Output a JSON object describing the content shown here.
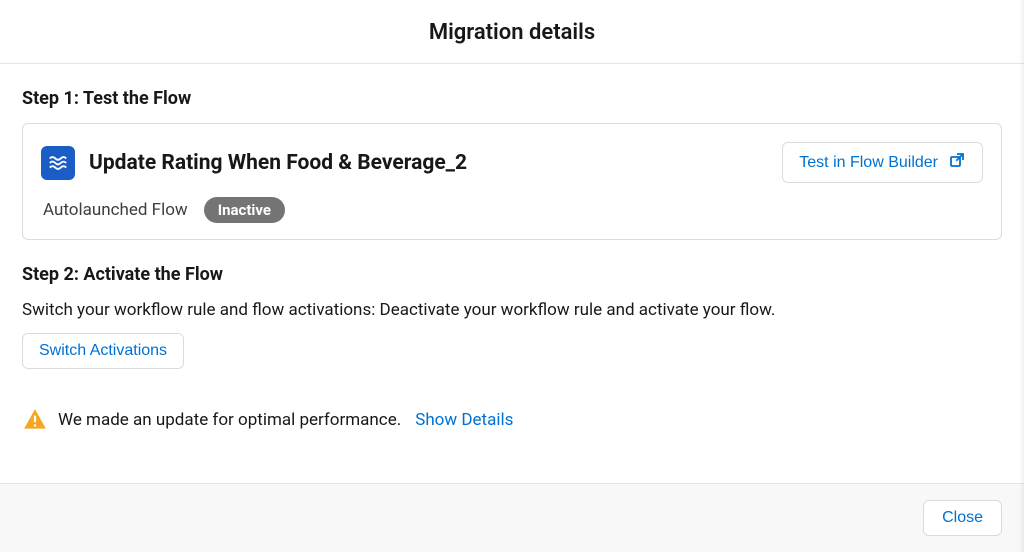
{
  "modal": {
    "title": "Migration details"
  },
  "step1": {
    "heading": "Step 1: Test the Flow",
    "flow_name": "Update Rating When Food & Beverage_2",
    "test_button_label": "Test in Flow Builder",
    "flow_type": "Autolaunched Flow",
    "status_label": "Inactive"
  },
  "step2": {
    "heading": "Step 2: Activate the Flow",
    "description": "Switch your workflow rule and flow activations: Deactivate your workflow rule and activate your flow.",
    "switch_button_label": "Switch Activations"
  },
  "notice": {
    "text": "We made an update for optimal performance.",
    "show_details_label": "Show Details"
  },
  "footer": {
    "close_label": "Close"
  }
}
